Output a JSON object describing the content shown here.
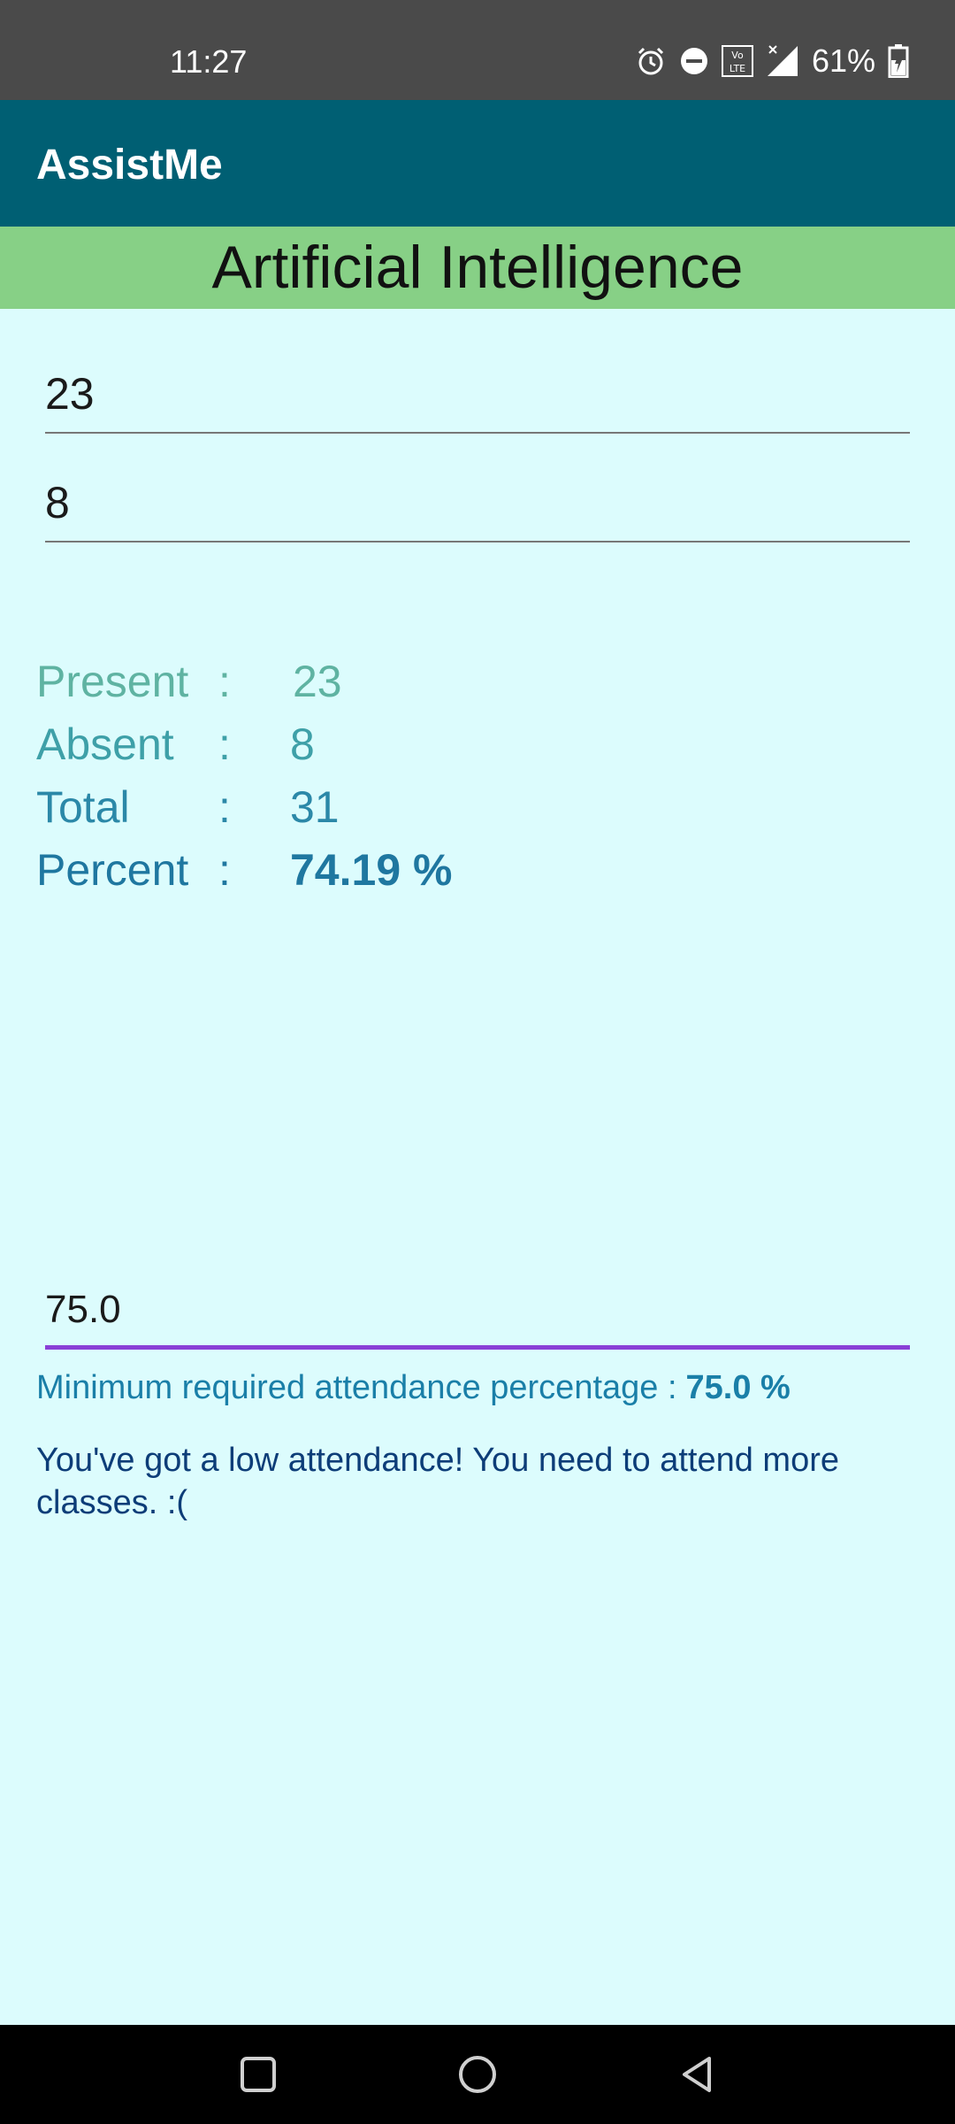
{
  "status_bar": {
    "time": "11:27",
    "battery": "61%",
    "icons": [
      "alarm-icon",
      "do-not-disturb-icon",
      "volte-icon",
      "signal-icon",
      "battery-charging-icon"
    ]
  },
  "app_bar": {
    "title": "AssistMe"
  },
  "subject": {
    "title": "Artificial Intelligence"
  },
  "inputs": {
    "present_value": "23",
    "absent_value": "8",
    "min_required_value": "75.0"
  },
  "stats": {
    "present_label": "Present",
    "present_value": "23",
    "absent_label": "Absent",
    "absent_value": "8",
    "total_label": "Total",
    "total_value": "31",
    "percent_label": "Percent",
    "percent_value": "74.19 %",
    "colon": ":"
  },
  "minimum": {
    "label": "Minimum required attendance percentage :",
    "value": "75.0 %"
  },
  "message": "You've got a low attendance! You need to attend more classes. :(",
  "nav": [
    "recents-button",
    "home-button",
    "back-button"
  ]
}
